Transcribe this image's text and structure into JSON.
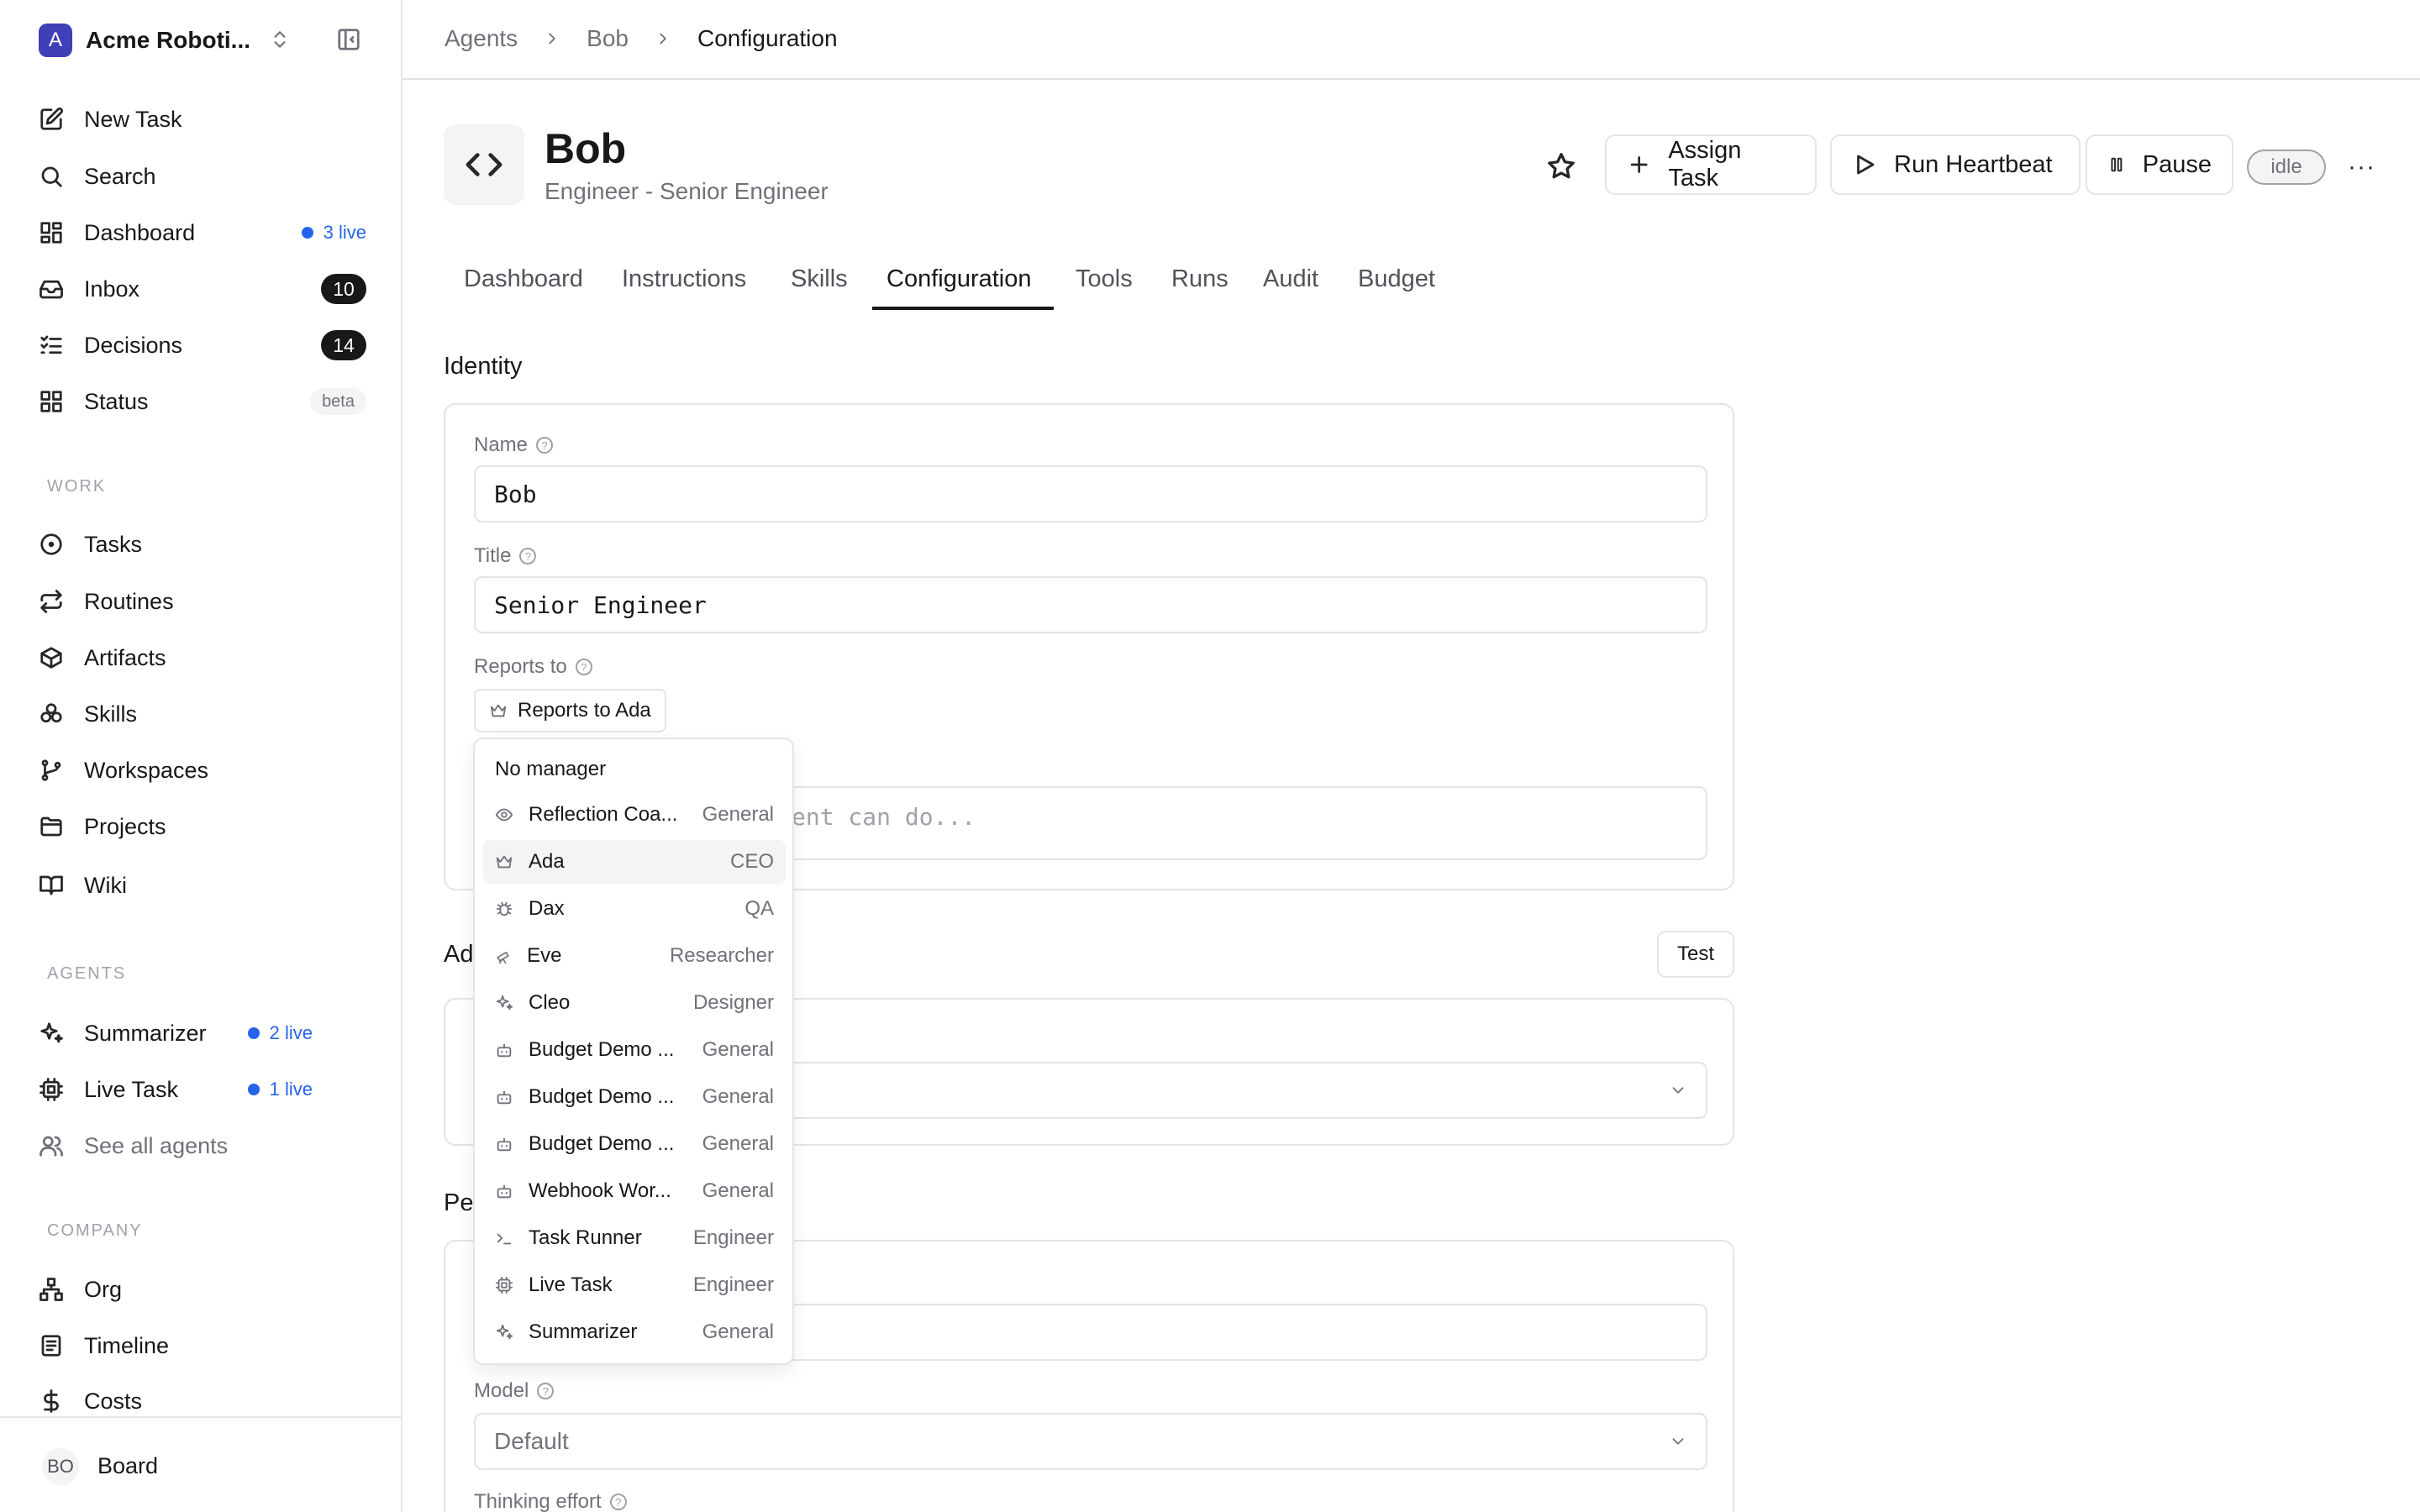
{
  "workspace": {
    "logo_letter": "A",
    "name": "Acme Roboti..."
  },
  "nav_main": [
    {
      "label": "New Task",
      "icon": "pencil-square-icon"
    },
    {
      "label": "Search",
      "icon": "search-icon"
    },
    {
      "label": "Dashboard",
      "icon": "grid-icon",
      "live": "3 live"
    },
    {
      "label": "Inbox",
      "icon": "inbox-icon",
      "count": "10"
    },
    {
      "label": "Decisions",
      "icon": "checklist-icon",
      "count": "14"
    },
    {
      "label": "Status",
      "icon": "grid-icon",
      "badge": "beta"
    }
  ],
  "sections": {
    "work": "WORK",
    "agents": "AGENTS",
    "company": "COMPANY"
  },
  "nav_work": [
    {
      "label": "Tasks",
      "icon": "circle-dot-icon"
    },
    {
      "label": "Routines",
      "icon": "repeat-icon"
    },
    {
      "label": "Artifacts",
      "icon": "box-icon"
    },
    {
      "label": "Skills",
      "icon": "skills-icon"
    },
    {
      "label": "Workspaces",
      "icon": "git-branch-icon"
    },
    {
      "label": "Projects",
      "icon": "folder-icon"
    },
    {
      "label": "Wiki",
      "icon": "book-icon"
    }
  ],
  "nav_agents": [
    {
      "label": "Summarizer",
      "icon": "sparkle-icon",
      "live": "2 live"
    },
    {
      "label": "Live Task",
      "icon": "cpu-icon",
      "live": "1 live"
    },
    {
      "label": "See all agents",
      "icon": "users-icon"
    }
  ],
  "nav_company": [
    {
      "label": "Org",
      "icon": "org-chart-icon"
    },
    {
      "label": "Timeline",
      "icon": "timeline-icon"
    },
    {
      "label": "Costs",
      "icon": "dollar-icon"
    }
  ],
  "user": {
    "initials": "BO",
    "name": "Board"
  },
  "breadcrumb": [
    "Agents",
    "Bob",
    "Configuration"
  ],
  "agent": {
    "name": "Bob",
    "subtitle": "Engineer - Senior Engineer",
    "status": "idle"
  },
  "actions": {
    "assign": "Assign Task",
    "heartbeat": "Run Heartbeat",
    "pause": "Pause",
    "more": "···"
  },
  "tabs": [
    "Dashboard",
    "Instructions",
    "Skills",
    "Configuration",
    "Tools",
    "Runs",
    "Audit",
    "Budget"
  ],
  "active_tab": "Configuration",
  "identity": {
    "heading": "Identity",
    "name_label": "Name",
    "name_value": "Bob",
    "title_label": "Title",
    "title_value": "Senior Engineer",
    "reports_label": "Reports to",
    "reports_value": "Reports to Ada",
    "capabilities_placeholder": "Describe what this agent can do..."
  },
  "adapter": {
    "heading_partial": "Ad",
    "test_label": "Test"
  },
  "permissions": {
    "heading_partial": "Pe",
    "model_label": "Model",
    "model_value": "Default",
    "thinking_label": "Thinking effort"
  },
  "dropdown": {
    "none_label": "No manager",
    "items": [
      {
        "name": "Reflection Coa...",
        "role": "General",
        "icon": "eye-icon"
      },
      {
        "name": "Ada",
        "role": "CEO",
        "icon": "crown-icon",
        "selected": true
      },
      {
        "name": "Dax",
        "role": "QA",
        "icon": "bug-icon"
      },
      {
        "name": "Eve",
        "role": "Researcher",
        "icon": "telescope-icon"
      },
      {
        "name": "Cleo",
        "role": "Designer",
        "icon": "sparkle-icon"
      },
      {
        "name": "Budget Demo ...",
        "role": "General",
        "icon": "bot-icon"
      },
      {
        "name": "Budget Demo ...",
        "role": "General",
        "icon": "bot-icon"
      },
      {
        "name": "Budget Demo ...",
        "role": "General",
        "icon": "bot-icon"
      },
      {
        "name": "Webhook Wor...",
        "role": "General",
        "icon": "bot-icon"
      },
      {
        "name": "Task Runner",
        "role": "Engineer",
        "icon": "terminal-icon"
      },
      {
        "name": "Live Task",
        "role": "Engineer",
        "icon": "cpu-icon"
      },
      {
        "name": "Summarizer",
        "role": "General",
        "icon": "sparkle-icon"
      }
    ]
  }
}
